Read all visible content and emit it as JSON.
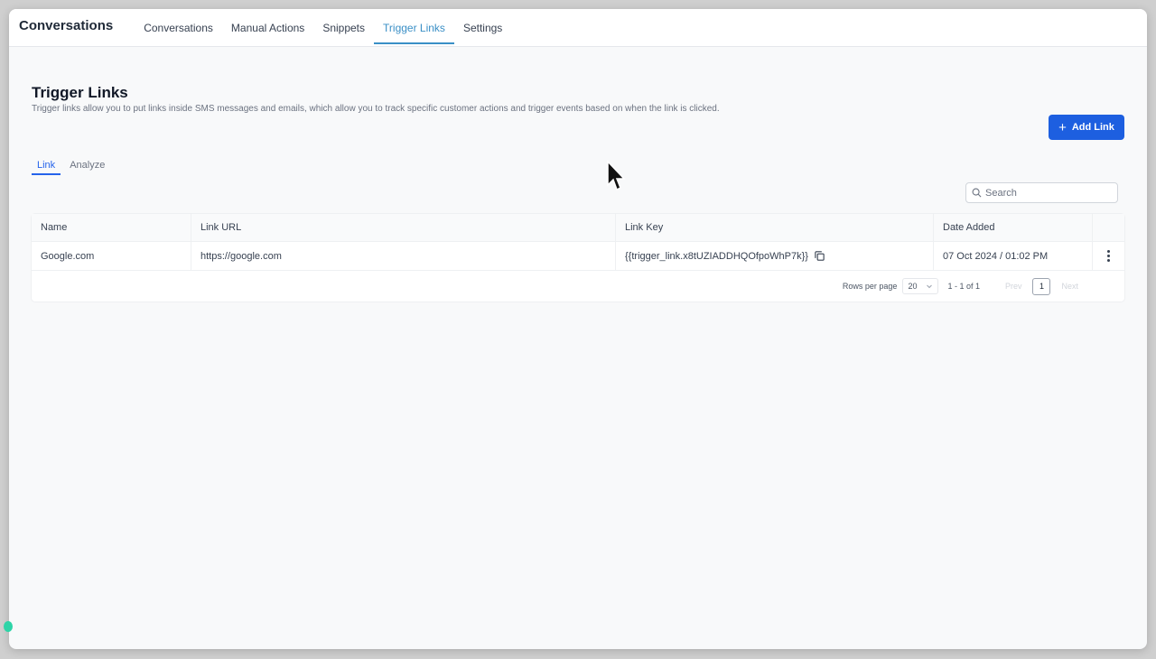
{
  "header": {
    "app_title": "Conversations",
    "nav": [
      {
        "label": "Conversations"
      },
      {
        "label": "Manual Actions"
      },
      {
        "label": "Snippets"
      },
      {
        "label": "Trigger Links",
        "active": true
      },
      {
        "label": "Settings"
      }
    ]
  },
  "page": {
    "title": "Trigger Links",
    "description": "Trigger links allow you to put links inside SMS messages and emails, which allow you to track specific customer actions and trigger events based on when the link is clicked.",
    "add_button": "Add Link",
    "subtabs": [
      {
        "label": "Link",
        "active": true
      },
      {
        "label": "Analyze"
      }
    ],
    "search": {
      "placeholder": "Search",
      "icon": "search-icon"
    }
  },
  "table": {
    "columns": [
      "Name",
      "Link URL",
      "Link Key",
      "Date Added"
    ],
    "rows": [
      {
        "name": "Google.com",
        "url": "https://google.com",
        "key": "{{trigger_link.x8tUZIADDHQOfpoWhP7k}}",
        "date": "07 Oct 2024 / 01:02 PM"
      }
    ],
    "pagination": {
      "rows_per_page_label": "Rows per page",
      "rows_per_page": "20",
      "range": "1 - 1 of 1",
      "prev": "Prev",
      "current_page": "1",
      "next": "Next"
    }
  },
  "colors": {
    "accent": "#1d5fe0",
    "active_tab": "#3a8fc6"
  }
}
